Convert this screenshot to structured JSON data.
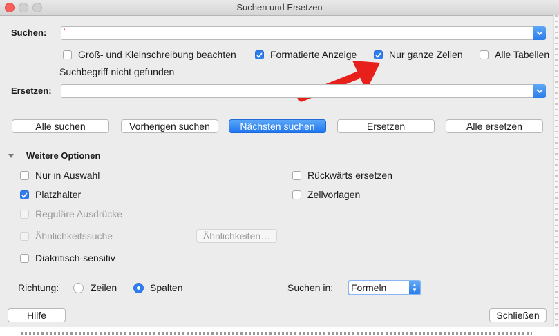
{
  "window": {
    "title": "Suchen und Ersetzen"
  },
  "search": {
    "label": "Suchen:",
    "value": "'"
  },
  "options_top": [
    {
      "label": "Groß- und Kleinschreibung beachten",
      "checked": false
    },
    {
      "label": "Formatierte Anzeige",
      "checked": true
    },
    {
      "label": "Nur ganze Zellen",
      "checked": true
    },
    {
      "label": "Alle Tabellen",
      "checked": false
    }
  ],
  "status_text": "Suchbegriff nicht gefunden",
  "replace": {
    "label": "Ersetzen:",
    "value": ""
  },
  "buttons": {
    "find_all": "Alle suchen",
    "find_prev": "Vorherigen suchen",
    "find_next": "Nächsten suchen",
    "replace": "Ersetzen",
    "replace_all": "Alle ersetzen",
    "similarities": "Ähnlichkeiten…",
    "help": "Hilfe",
    "close": "Schließen"
  },
  "more_options": {
    "label": "Weitere Optionen",
    "expanded": true,
    "left": [
      {
        "label": "Nur in Auswahl",
        "checked": false,
        "enabled": true
      },
      {
        "label": "Platzhalter",
        "checked": true,
        "enabled": true
      },
      {
        "label": "Reguläre Ausdrücke",
        "checked": false,
        "enabled": false
      },
      {
        "label": "Ähnlichkeitssuche",
        "checked": false,
        "enabled": false
      },
      {
        "label": "Diakritisch-sensitiv",
        "checked": false,
        "enabled": true
      }
    ],
    "right": [
      {
        "label": "Rückwärts ersetzen",
        "checked": false
      },
      {
        "label": "Zellvorlagen",
        "checked": false
      }
    ]
  },
  "direction": {
    "label": "Richtung:",
    "options": [
      "Zeilen",
      "Spalten"
    ],
    "selected": "Spalten"
  },
  "search_in": {
    "label": "Suchen in:",
    "value": "Formeln"
  },
  "annotation": {
    "arrow_color": "#e8201c"
  },
  "colors": {
    "accent": "#2f7ef0"
  }
}
